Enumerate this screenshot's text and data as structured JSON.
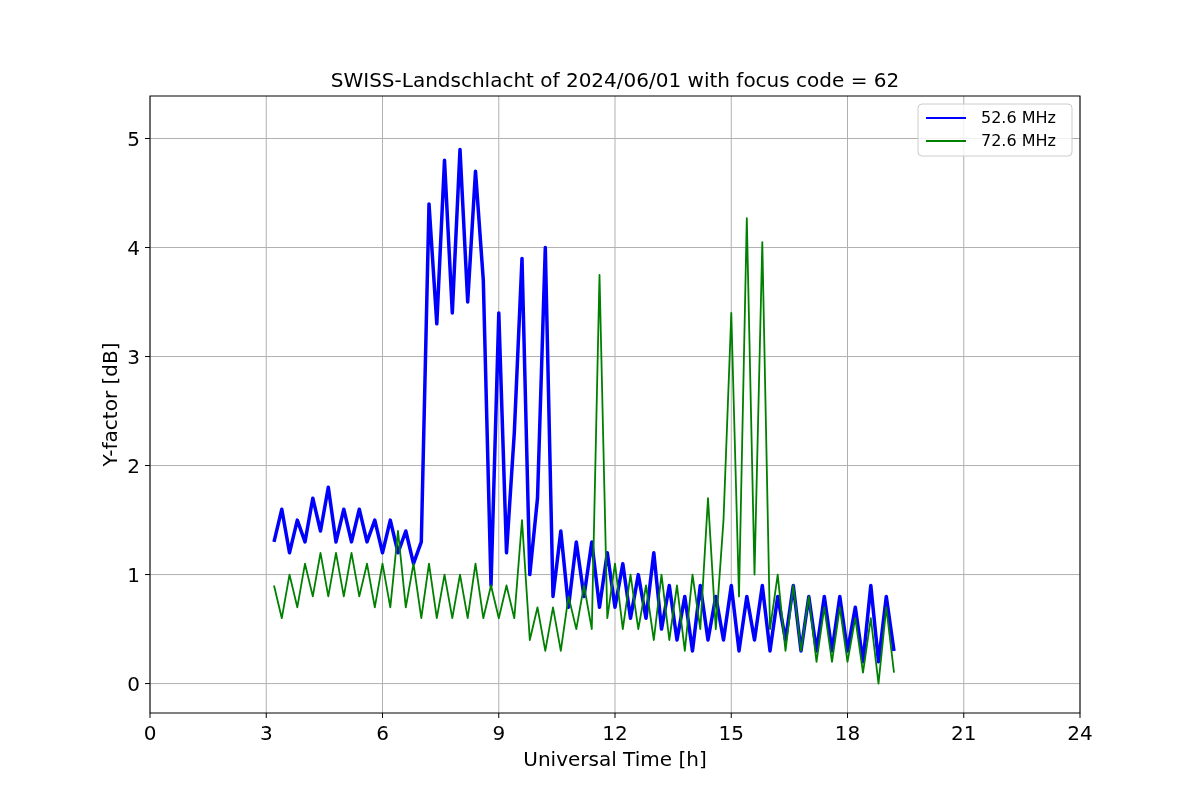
{
  "chart_data": {
    "type": "line",
    "title": "SWISS-Landschlacht of 2024/06/01 with focus code = 62",
    "xlabel": "Universal Time [h]",
    "ylabel": "Y-factor [dB]",
    "x": [
      3.2,
      3.4,
      3.6,
      3.8,
      4.0,
      4.2,
      4.4,
      4.6,
      4.8,
      5.0,
      5.2,
      5.4,
      5.6,
      5.8,
      6.0,
      6.2,
      6.4,
      6.6,
      6.8,
      7.0,
      7.2,
      7.4,
      7.6,
      7.8,
      8.0,
      8.2,
      8.4,
      8.6,
      8.8,
      9.0,
      9.2,
      9.4,
      9.6,
      9.8,
      10.0,
      10.2,
      10.4,
      10.6,
      10.8,
      11.0,
      11.2,
      11.4,
      11.6,
      11.8,
      12.0,
      12.2,
      12.4,
      12.6,
      12.8,
      13.0,
      13.2,
      13.4,
      13.6,
      13.8,
      14.0,
      14.2,
      14.4,
      14.6,
      14.8,
      15.0,
      15.2,
      15.4,
      15.6,
      15.8,
      16.0,
      16.2,
      16.4,
      16.6,
      16.8,
      17.0,
      17.2,
      17.4,
      17.6,
      17.8,
      18.0,
      18.2,
      18.4,
      18.6,
      18.8,
      19.0,
      19.2
    ],
    "series": [
      {
        "name": "52.6 MHz",
        "color": "#0000ff",
        "values": [
          1.3,
          1.6,
          1.2,
          1.5,
          1.3,
          1.7,
          1.4,
          1.8,
          1.3,
          1.6,
          1.3,
          1.6,
          1.3,
          1.5,
          1.2,
          1.5,
          1.2,
          1.4,
          1.1,
          1.3,
          4.4,
          3.3,
          4.8,
          3.4,
          4.9,
          3.5,
          4.7,
          3.7,
          0.9,
          3.4,
          1.2,
          2.3,
          3.9,
          1.0,
          1.7,
          4.0,
          0.8,
          1.4,
          0.7,
          1.3,
          0.8,
          1.3,
          0.7,
          1.2,
          0.7,
          1.1,
          0.6,
          1.0,
          0.6,
          1.2,
          0.5,
          0.9,
          0.4,
          0.8,
          0.3,
          0.9,
          0.4,
          0.8,
          0.4,
          0.9,
          0.3,
          0.8,
          0.4,
          0.9,
          0.3,
          0.8,
          0.4,
          0.9,
          0.3,
          0.8,
          0.3,
          0.8,
          0.3,
          0.8,
          0.3,
          0.7,
          0.2,
          0.9,
          0.2,
          0.8,
          0.3
        ]
      },
      {
        "name": "72.6 MHz",
        "color": "#008000",
        "values": [
          0.9,
          0.6,
          1.0,
          0.7,
          1.1,
          0.8,
          1.2,
          0.8,
          1.2,
          0.8,
          1.2,
          0.8,
          1.1,
          0.7,
          1.1,
          0.7,
          1.4,
          0.7,
          1.1,
          0.6,
          1.1,
          0.6,
          1.0,
          0.6,
          1.0,
          0.6,
          1.1,
          0.6,
          0.9,
          0.6,
          0.9,
          0.6,
          1.5,
          0.4,
          0.7,
          0.3,
          0.7,
          0.3,
          0.8,
          0.5,
          0.9,
          0.5,
          3.75,
          0.6,
          1.1,
          0.5,
          1.0,
          0.5,
          0.9,
          0.4,
          1.0,
          0.4,
          0.9,
          0.3,
          1.0,
          0.5,
          1.7,
          0.5,
          1.5,
          3.4,
          0.8,
          4.27,
          1.0,
          4.05,
          0.5,
          1.0,
          0.3,
          0.9,
          0.3,
          0.8,
          0.2,
          0.7,
          0.2,
          0.7,
          0.2,
          0.6,
          0.1,
          0.6,
          0.0,
          0.7,
          0.1
        ]
      }
    ],
    "xlim": [
      0,
      24
    ],
    "ylim": [
      -0.27,
      5.39
    ],
    "xticks": [
      0,
      3,
      6,
      9,
      12,
      15,
      18,
      21,
      24
    ],
    "yticks": [
      0,
      1,
      2,
      3,
      4,
      5
    ],
    "grid": true,
    "legend": true
  }
}
